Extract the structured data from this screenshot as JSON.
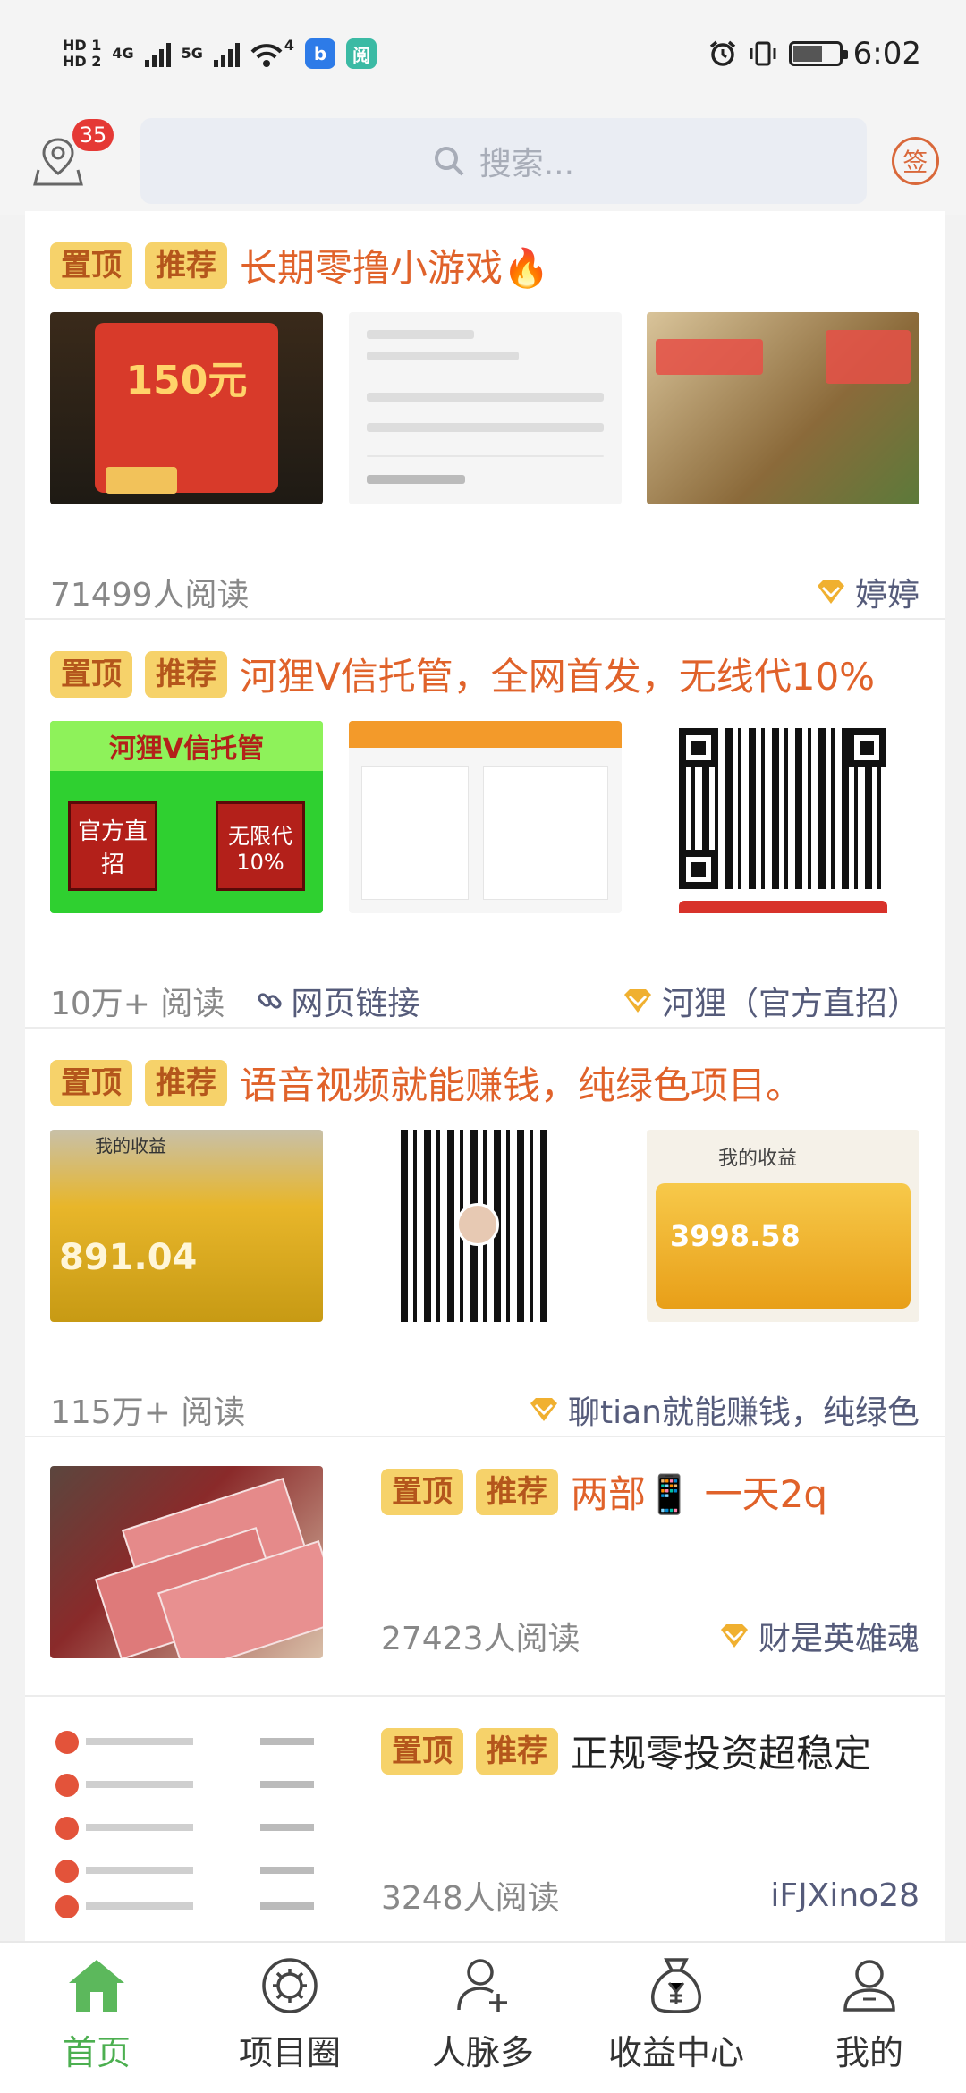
{
  "status_bar": {
    "hd1": "HD 1",
    "hd2": "HD 2",
    "net1": "4G",
    "net2": "5G",
    "wifi_num": "4",
    "app1": "b",
    "app2": "阅",
    "time": "6:02"
  },
  "header": {
    "badge_count": "35",
    "search_placeholder": "搜索...",
    "sign_label": "签"
  },
  "feed": [
    {
      "tags": [
        "置顶",
        "推荐"
      ],
      "title": "长期零撸小游戏🔥",
      "thumb_text": "150元",
      "reads": "71499人阅读",
      "author": "婷婷"
    },
    {
      "tags": [
        "置顶",
        "推荐"
      ],
      "title": "河狸V信托管，全网首发，无线代10%",
      "thumb_text": [
        "河狸V信托管",
        "官方直招",
        "无限代10%"
      ],
      "reads": "10万+ 阅读",
      "link": "网页链接",
      "author": "河狸（官方直招）"
    },
    {
      "tags": [
        "置顶",
        "推荐"
      ],
      "title": "语音视频就能赚钱，纯绿色项目。",
      "thumb_text": [
        "我的收益",
        "891.04",
        "我的收益",
        "3998.58"
      ],
      "reads": "115万+ 阅读",
      "author": "聊tian就能赚钱，纯绿色"
    },
    {
      "tags": [
        "置顶",
        "推荐"
      ],
      "title": "两部📱 一天2q",
      "reads": "27423人阅读",
      "author": "财是英雄魂"
    },
    {
      "tags": [
        "置顶",
        "推荐"
      ],
      "title": "正规零投资超稳定",
      "reads": "3248人阅读",
      "author": "iFJXino28"
    }
  ],
  "bottom_nav": [
    {
      "label": "首页",
      "icon": "home-icon",
      "active": true
    },
    {
      "label": "项目圈",
      "icon": "settings-circle-icon",
      "active": false
    },
    {
      "label": "人脉多",
      "icon": "add-user-icon",
      "active": false
    },
    {
      "label": "收益中心",
      "icon": "money-bag-icon",
      "active": false
    },
    {
      "label": "我的",
      "icon": "profile-icon",
      "active": false
    }
  ],
  "colors": {
    "accent_green": "#4caf50",
    "title_orange": "#e0622a",
    "tag_bg": "#f6d26a",
    "badge_red": "#e53935",
    "diamond": "#f0b030"
  }
}
